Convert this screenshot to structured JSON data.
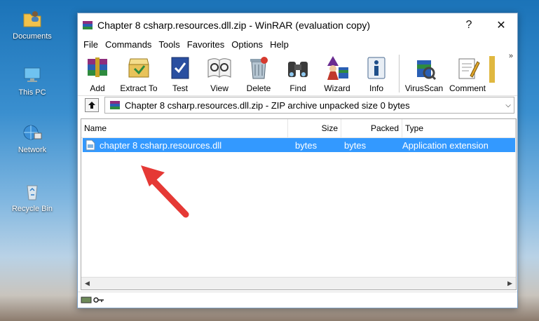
{
  "desktop": {
    "icons": [
      {
        "label": "Documents",
        "icon": "folder-user-icon"
      },
      {
        "label": "This PC",
        "icon": "computer-icon"
      },
      {
        "label": "Network",
        "icon": "network-icon"
      },
      {
        "label": "Recycle Bin",
        "icon": "recycle-bin-icon"
      }
    ]
  },
  "window": {
    "title": "Chapter 8 csharp.resources.dll.zip - WinRAR (evaluation copy)",
    "help_glyph": "?",
    "close_glyph": "✕"
  },
  "menu": [
    "File",
    "Commands",
    "Tools",
    "Favorites",
    "Options",
    "Help"
  ],
  "toolbar": [
    "Add",
    "Extract To",
    "Test",
    "View",
    "Delete",
    "Find",
    "Wizard",
    "Info",
    "VirusScan",
    "Comment"
  ],
  "toolbar_overflow": "»",
  "address": {
    "text": "Chapter 8 csharp.resources.dll.zip - ZIP archive unpacked size 0 bytes"
  },
  "columns": [
    "Name",
    "Size",
    "Packed",
    "Type"
  ],
  "files": [
    {
      "name": "chapter 8 csharp.resources.dll",
      "size": "bytes",
      "packed": "bytes",
      "type": "Application extension",
      "selected": true
    }
  ],
  "colors": {
    "selection": "#3399ff",
    "arrow": "#e53935"
  }
}
